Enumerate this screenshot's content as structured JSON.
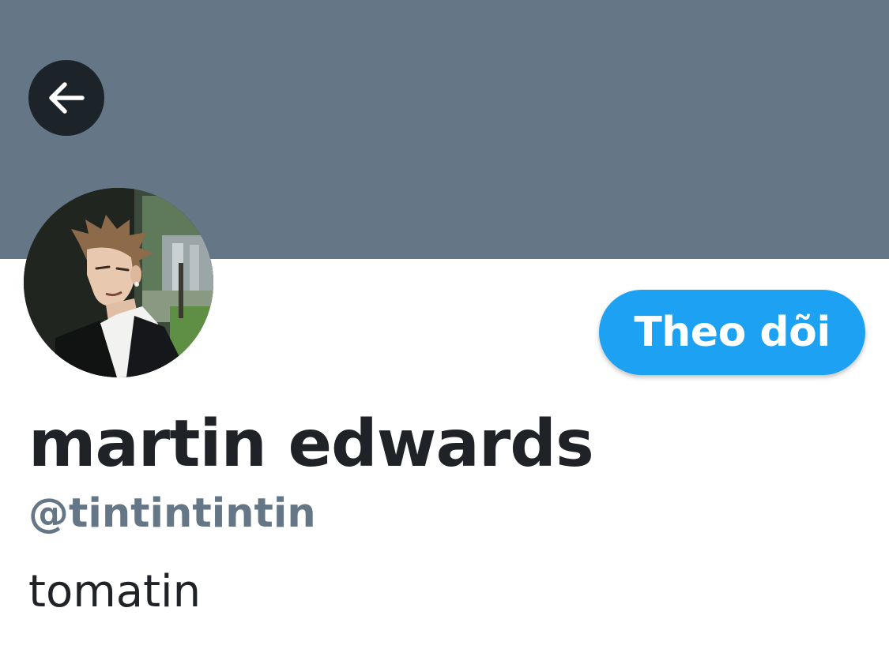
{
  "colors": {
    "banner": "#657786",
    "accent": "#1da1f2",
    "text_primary": "#1f2226",
    "text_secondary": "#657786"
  },
  "header": {
    "back_icon": "arrow-left-icon"
  },
  "profile": {
    "avatar_icon": "profile-photo",
    "follow_label": "Theo dõi",
    "display_name": "martin edwards",
    "handle": "@tintintintin",
    "bio": "tomatin"
  }
}
